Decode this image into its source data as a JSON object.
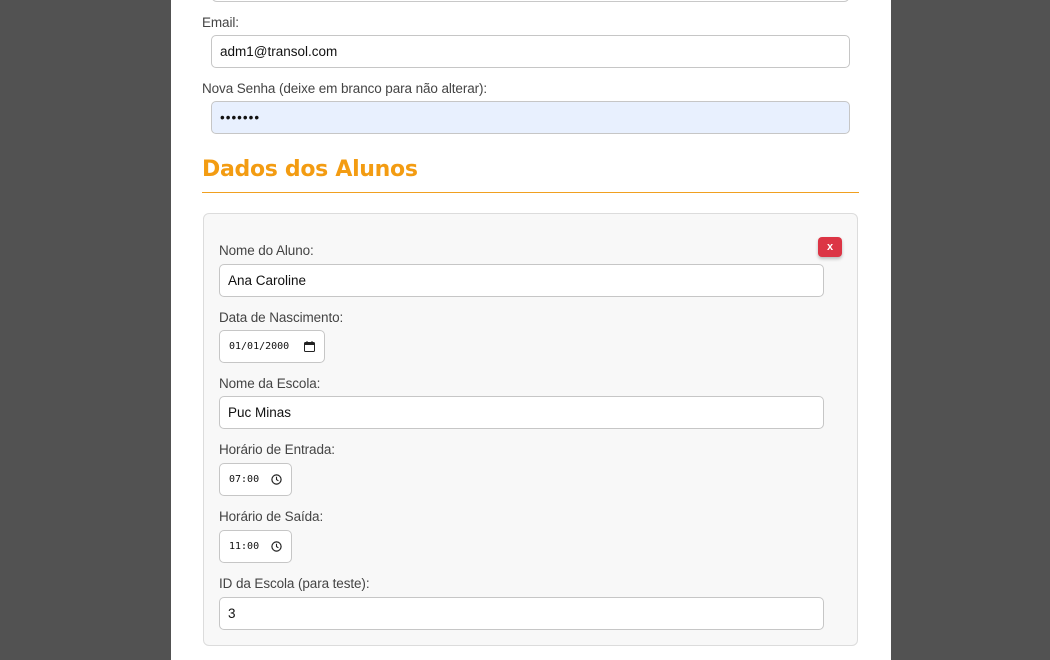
{
  "account": {
    "email_label": "Email:",
    "email_value": "adm1@transol.com",
    "password_label": "Nova Senha (deixe em branco para não alterar):",
    "password_value": "•••••••"
  },
  "students_section": {
    "title": "Dados dos Alunos",
    "remove_label": "x",
    "student": {
      "name_label": "Nome do Aluno:",
      "name_value": "Ana Caroline",
      "birth_label": "Data de Nascimento:",
      "birth_value": "01/01/2000",
      "school_label": "Nome da Escola:",
      "school_value": "Puc Minas",
      "entry_label": "Horário de Entrada:",
      "entry_value": "07:00",
      "exit_label": "Horário de Saída:",
      "exit_value": "11:00",
      "school_id_label": "ID da Escola (para teste):",
      "school_id_value": "3"
    }
  },
  "icons": {
    "date_picker": "calendar-icon",
    "time_picker": "clock-icon",
    "remove": "close-icon"
  },
  "colors": {
    "background": "#525252",
    "accent": "#f39c12",
    "danger": "#dc3545",
    "autofill": "#e8f0fe"
  }
}
